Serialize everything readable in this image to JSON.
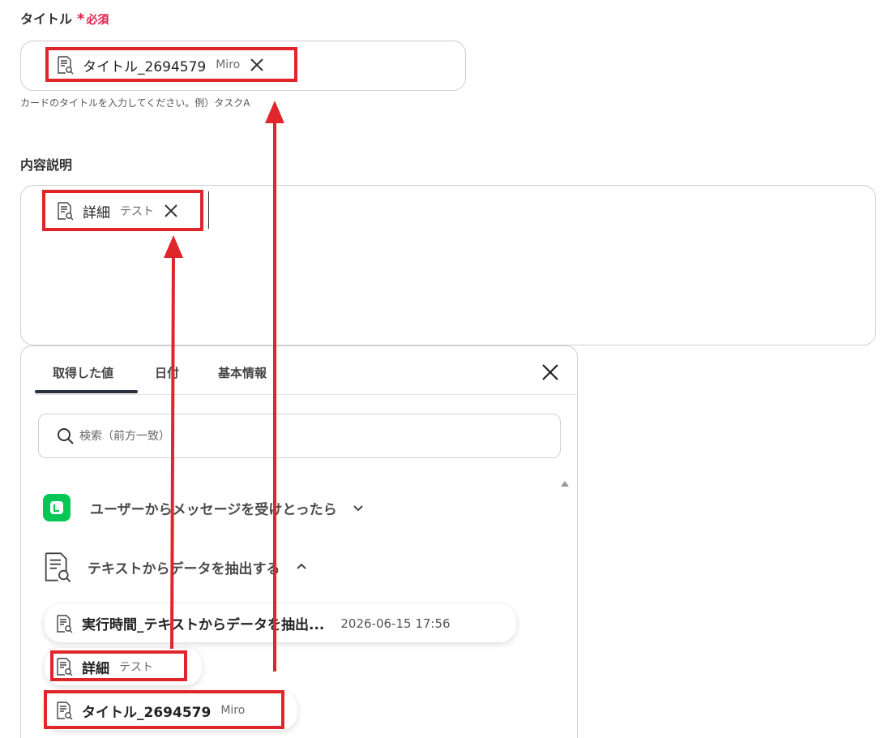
{
  "title_field": {
    "label": "タイトル",
    "required_mark": "*",
    "required_text": "必須",
    "token": {
      "name": "タイトル_2694579",
      "source": "Miro"
    },
    "hint": "カードのタイトルを入力してください。例）タスクA"
  },
  "description_field": {
    "label": "内容説明",
    "token": {
      "name": "詳細",
      "source": "テスト"
    }
  },
  "picker": {
    "tabs": [
      "取得した値",
      "日付",
      "基本情報"
    ],
    "active_tab": "取得した値",
    "search_placeholder": "検索（前方一致）",
    "groups": [
      {
        "label": "ユーザーからメッセージを受けとったら",
        "icon": "line-app-icon",
        "expanded": false
      },
      {
        "label": "テキストからデータを抽出する",
        "icon": "document-search-icon",
        "expanded": true
      }
    ],
    "items": [
      {
        "name": "実行時間_テキストからデータを抽出...",
        "meta": "2026-06-15 17:56"
      },
      {
        "name": "詳細",
        "source": "テスト"
      },
      {
        "name": "タイトル_2694579",
        "source": "Miro"
      }
    ]
  },
  "colors": {
    "annotation_red": "#e0262a",
    "required_pink": "#e0204a",
    "line_green": "#06c755"
  }
}
